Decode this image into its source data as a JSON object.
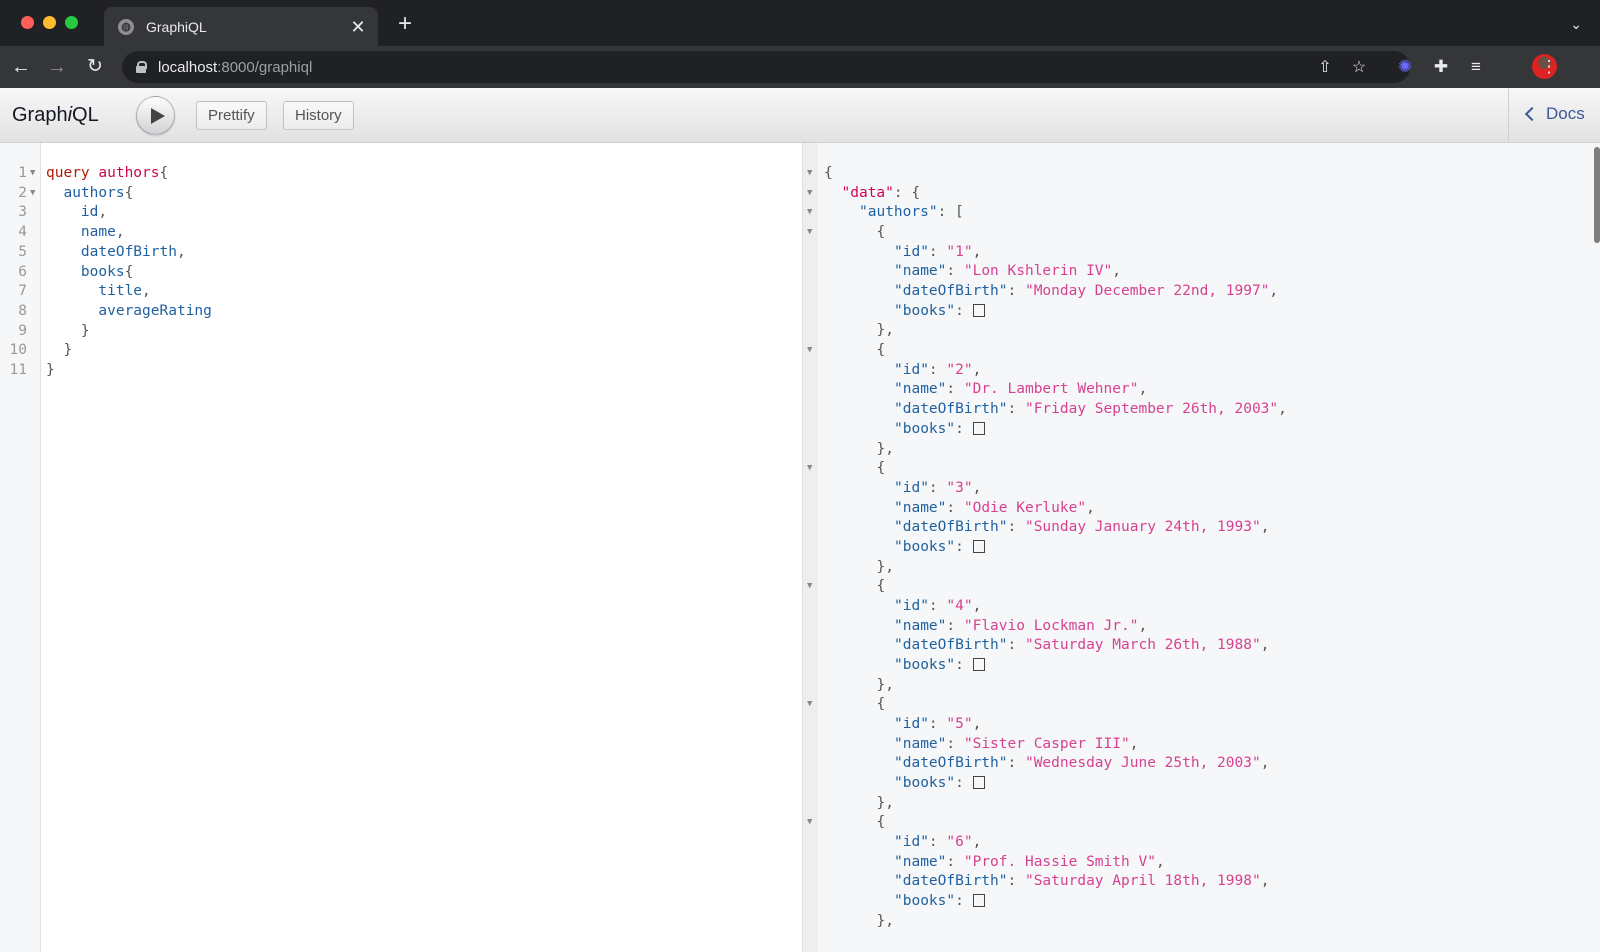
{
  "browser": {
    "tab_title": "GraphiQL",
    "url_host": "localhost",
    "url_rest": ":8000/graphiql",
    "icons": {
      "tab_favicon": "globe-icon",
      "tab_close": "✕",
      "new_tab": "+",
      "tab_search": "⌄",
      "back": "←",
      "forward": "→",
      "reload": "↻",
      "share": "⇧",
      "bookmark": "☆",
      "extension_1": "✺",
      "extensions": "✚",
      "media": "≡",
      "menu": "⋮"
    }
  },
  "graphiql": {
    "title_pre": "Graph",
    "title_i": "i",
    "title_post": "QL",
    "prettify_label": "Prettify",
    "history_label": "History",
    "docs_label": "Docs"
  },
  "query_lines": [
    {
      "n": "1",
      "fold": true,
      "tokens": [
        {
          "t": "query",
          "c": "kw"
        },
        {
          "t": " ",
          "c": "punct"
        },
        {
          "t": "authors",
          "c": "def"
        },
        {
          "t": "{",
          "c": "punct"
        }
      ]
    },
    {
      "n": "2",
      "fold": true,
      "tokens": [
        {
          "t": "  ",
          "c": "punct"
        },
        {
          "t": "authors",
          "c": "field"
        },
        {
          "t": "{",
          "c": "punct"
        }
      ]
    },
    {
      "n": "3",
      "fold": false,
      "tokens": [
        {
          "t": "    ",
          "c": "punct"
        },
        {
          "t": "id",
          "c": "field"
        },
        {
          "t": ",",
          "c": "punct"
        }
      ]
    },
    {
      "n": "4",
      "fold": false,
      "tokens": [
        {
          "t": "    ",
          "c": "punct"
        },
        {
          "t": "name",
          "c": "field"
        },
        {
          "t": ",",
          "c": "punct"
        }
      ]
    },
    {
      "n": "5",
      "fold": false,
      "tokens": [
        {
          "t": "    ",
          "c": "punct"
        },
        {
          "t": "dateOfBirth",
          "c": "field"
        },
        {
          "t": ",",
          "c": "punct"
        }
      ]
    },
    {
      "n": "6",
      "fold": false,
      "tokens": [
        {
          "t": "    ",
          "c": "punct"
        },
        {
          "t": "books",
          "c": "field"
        },
        {
          "t": "{",
          "c": "punct"
        }
      ]
    },
    {
      "n": "7",
      "fold": false,
      "tokens": [
        {
          "t": "      ",
          "c": "punct"
        },
        {
          "t": "title",
          "c": "field"
        },
        {
          "t": ",",
          "c": "punct"
        }
      ]
    },
    {
      "n": "8",
      "fold": false,
      "tokens": [
        {
          "t": "      ",
          "c": "punct"
        },
        {
          "t": "averageRating",
          "c": "field"
        }
      ]
    },
    {
      "n": "9",
      "fold": false,
      "tokens": [
        {
          "t": "    ",
          "c": "punct"
        },
        {
          "t": "}",
          "c": "punct"
        }
      ]
    },
    {
      "n": "10",
      "fold": false,
      "tokens": [
        {
          "t": "  ",
          "c": "punct"
        },
        {
          "t": "}",
          "c": "punct"
        }
      ]
    },
    {
      "n": "11",
      "fold": false,
      "tokens": [
        {
          "t": "}",
          "c": "punct"
        }
      ]
    }
  ],
  "result": {
    "root_key": "data",
    "list_key": "authors",
    "authors": [
      {
        "id": "1",
        "name": "Lon Kshlerin IV",
        "dateOfBirth": "Monday December 22nd, 1997",
        "books": "[]"
      },
      {
        "id": "2",
        "name": "Dr. Lambert Wehner",
        "dateOfBirth": "Friday September 26th, 2003",
        "books": "[]"
      },
      {
        "id": "3",
        "name": "Odie Kerluke",
        "dateOfBirth": "Sunday January 24th, 1993",
        "books": "[]"
      },
      {
        "id": "4",
        "name": "Flavio Lockman Jr.",
        "dateOfBirth": "Saturday March 26th, 1988",
        "books": "[]"
      },
      {
        "id": "5",
        "name": "Sister Casper III",
        "dateOfBirth": "Wednesday June 25th, 2003",
        "books": "[]"
      },
      {
        "id": "6",
        "name": "Prof. Hassie Smith V",
        "dateOfBirth": "Saturday April 18th, 1998",
        "books": "[]"
      }
    ]
  }
}
